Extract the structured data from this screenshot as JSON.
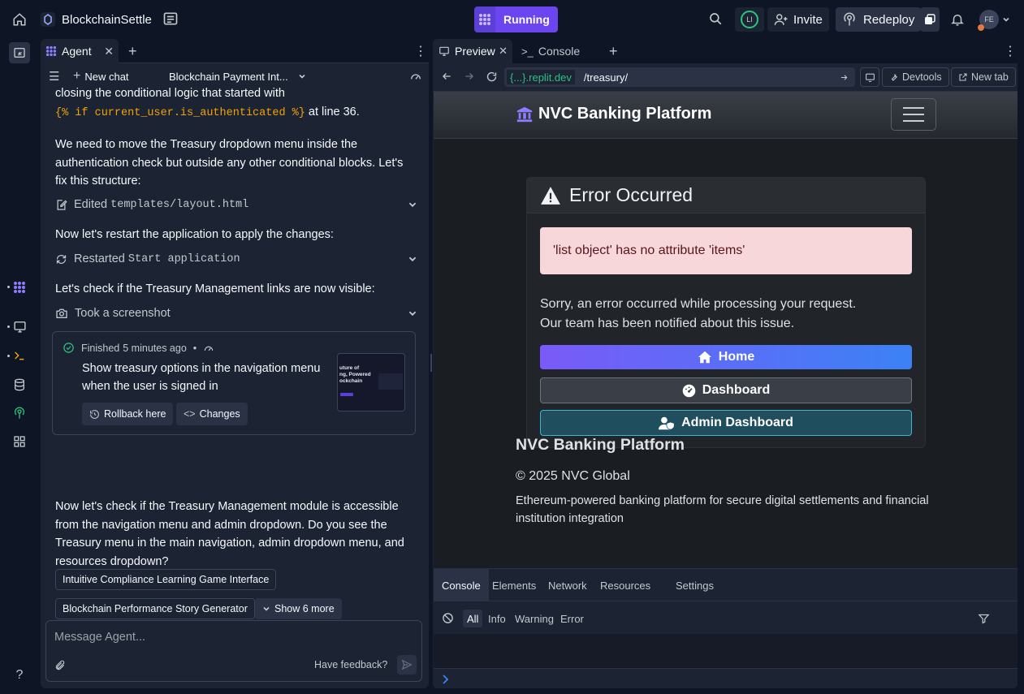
{
  "topbar": {
    "project_name": "BlockchainSettle",
    "run_label": "Running",
    "user_initials_left": "LI",
    "invite_label": "Invite",
    "redeploy_label": "Redeploy",
    "avatar_initials": "FE"
  },
  "agent": {
    "tab_label": "Agent",
    "new_chat_label": "New chat",
    "chat_title": "Blockchain Payment Int...",
    "messages": {
      "m1_a": "closing the conditional logic that started with",
      "m1_code": "{% if current_user.is_authenticated %}",
      "m1_b": "at line 36.",
      "m2": "We need to move the Treasury dropdown menu inside the authentication check but outside any other conditional blocks. Let's fix this structure:",
      "m3": "Now let's restart the application to apply the changes:",
      "m4": "Let's check if the Treasury Management links are now visible:",
      "m5": "Now let's check if the Treasury Management module is accessible from the navigation menu and admin dropdown. Do you see the Treasury menu in the main navigation, admin dropdown menu, and resources dropdown?"
    },
    "actions": {
      "edited_label": "Edited",
      "edited_file": "templates/layout.html",
      "restarted_label": "Restarted",
      "restarted_target": "Start application",
      "screenshot_label": "Took a screenshot"
    },
    "checkpoint": {
      "status": "Finished",
      "time": "5 minutes ago",
      "separator": "•",
      "description": "Show treasury options in the navigation menu when the user is signed in",
      "rollback_label": "Rollback here",
      "changes_label": "Changes",
      "thumb_text_1": "uture of",
      "thumb_text_2": "ng, Powered",
      "thumb_text_3": "ockchain"
    },
    "suggestions": [
      "Intuitive Compliance Learning Game Interface",
      "Blockchain Performance Story Generator"
    ],
    "show_more_label": "Show 6 more",
    "input_placeholder": "Message Agent...",
    "feedback_label": "Have feedback?"
  },
  "preview": {
    "tabs": [
      "Preview",
      "Console"
    ],
    "url_domain": "{...}.replit.dev",
    "url_path": "/treasury/",
    "devtools_label": "Devtools",
    "newtab_label": "New tab",
    "site": {
      "brand": "NVC Banking Platform",
      "error_title": "Error Occurred",
      "error_message": "'list object' has no attribute 'items'",
      "error_text": "Sorry, an error occurred while processing your request. Our team has been notified about this issue.",
      "home_label": "Home",
      "dashboard_label": "Dashboard",
      "admin_label": "Admin Dashboard",
      "footer_title": "NVC Banking Platform",
      "footer_copyright": "© 2025 NVC Global",
      "footer_desc": "Ethereum-powered banking platform for secure digital settlements and financial institution integration"
    },
    "devtools_tabs": [
      "Console",
      "Elements",
      "Network",
      "Resources",
      "Settings"
    ],
    "log_levels": [
      "All",
      "Info",
      "Warning",
      "Error"
    ]
  },
  "colors": {
    "accent": "#6a45f0",
    "bg": "#0e1525",
    "panel": "#1c2333",
    "success": "#2ec27e",
    "alert_bg": "#f8d7da"
  },
  "icons": [
    "home-icon",
    "files-icon",
    "search-icon",
    "user-plus-icon",
    "redeploy-icon",
    "bell-icon",
    "chevron-down-icon",
    "close-icon",
    "plus-icon",
    "kebab-icon",
    "edit-file-icon",
    "restart-icon",
    "camera-icon",
    "check-circle-icon",
    "history-icon",
    "code-icon",
    "paperclip-icon",
    "send-icon",
    "back-icon",
    "forward-icon",
    "refresh-icon",
    "bank-icon",
    "warning-icon",
    "dashboard-icon",
    "admin-icon",
    "clear-icon",
    "filter-icon"
  ]
}
